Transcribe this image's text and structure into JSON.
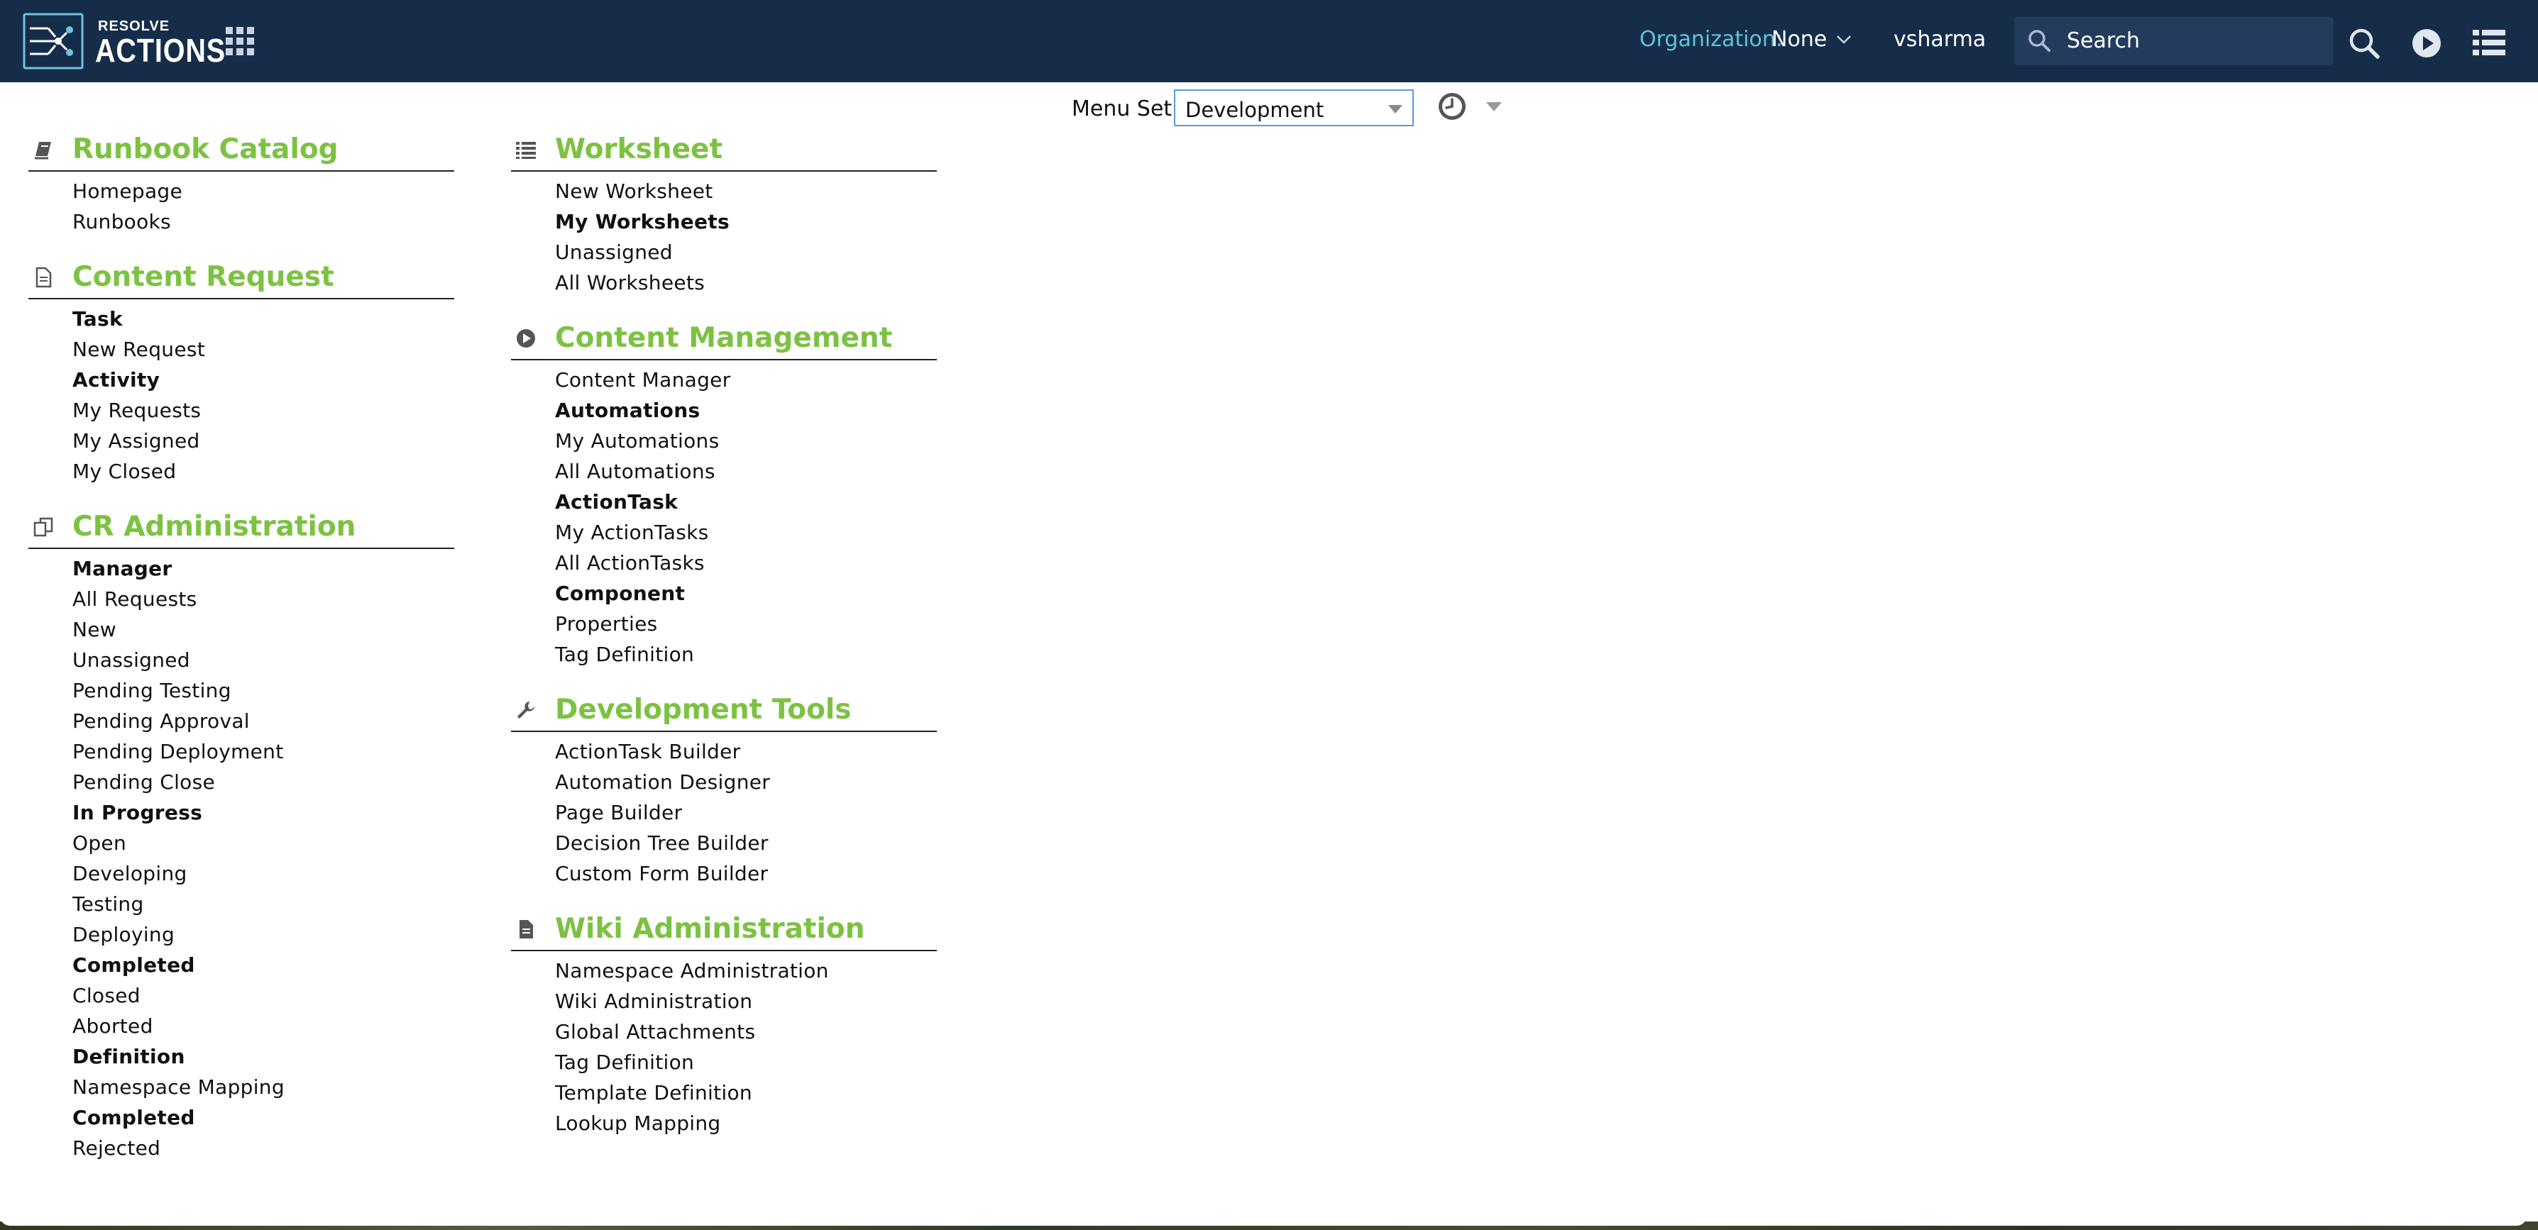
{
  "header": {
    "brand_top": "RESOLVE",
    "brand_main": "ACTIONS",
    "org_label": "Organization:",
    "org_value": "None",
    "username": "vsharma",
    "search_placeholder": "Search"
  },
  "menu_set": {
    "label": "Menu Set:",
    "value": "Development"
  },
  "columns": [
    [
      {
        "title": "Runbook Catalog",
        "icon": "book-icon",
        "items": [
          {
            "label": "Homepage",
            "group": false
          },
          {
            "label": "Runbooks",
            "group": false
          }
        ]
      },
      {
        "title": "Content Request",
        "icon": "document-icon",
        "items": [
          {
            "label": "Task",
            "group": true
          },
          {
            "label": "New Request",
            "group": false
          },
          {
            "label": "Activity",
            "group": true
          },
          {
            "label": "My Requests",
            "group": false
          },
          {
            "label": "My Assigned",
            "group": false
          },
          {
            "label": "My Closed",
            "group": false
          }
        ]
      },
      {
        "title": "CR Administration",
        "icon": "copy-icon",
        "items": [
          {
            "label": "Manager",
            "group": true
          },
          {
            "label": "All Requests",
            "group": false
          },
          {
            "label": "New",
            "group": false
          },
          {
            "label": "Unassigned",
            "group": false
          },
          {
            "label": "Pending Testing",
            "group": false
          },
          {
            "label": "Pending Approval",
            "group": false
          },
          {
            "label": "Pending Deployment",
            "group": false
          },
          {
            "label": "Pending Close",
            "group": false
          },
          {
            "label": "In Progress",
            "group": true
          },
          {
            "label": "Open",
            "group": false
          },
          {
            "label": "Developing",
            "group": false
          },
          {
            "label": "Testing",
            "group": false
          },
          {
            "label": "Deploying",
            "group": false
          },
          {
            "label": "Completed",
            "group": true
          },
          {
            "label": "Closed",
            "group": false
          },
          {
            "label": "Aborted",
            "group": false
          },
          {
            "label": "Definition",
            "group": true
          },
          {
            "label": "Namespace Mapping",
            "group": false
          },
          {
            "label": "Completed",
            "group": true
          },
          {
            "label": "Rejected",
            "group": false
          }
        ]
      }
    ],
    [
      {
        "title": "Worksheet",
        "icon": "list-icon",
        "items": [
          {
            "label": "New Worksheet",
            "group": false
          },
          {
            "label": "My Worksheets",
            "group": true
          },
          {
            "label": "Unassigned",
            "group": false
          },
          {
            "label": "All Worksheets",
            "group": false
          }
        ]
      },
      {
        "title": "Content Management",
        "icon": "play-circle-icon",
        "items": [
          {
            "label": "Content Manager",
            "group": false
          },
          {
            "label": "Automations",
            "group": true
          },
          {
            "label": "My Automations",
            "group": false
          },
          {
            "label": "All Automations",
            "group": false
          },
          {
            "label": "ActionTask",
            "group": true
          },
          {
            "label": "My ActionTasks",
            "group": false
          },
          {
            "label": "All ActionTasks",
            "group": false
          },
          {
            "label": "Component",
            "group": true
          },
          {
            "label": "Properties",
            "group": false
          },
          {
            "label": "Tag Definition",
            "group": false
          }
        ]
      },
      {
        "title": "Development Tools",
        "icon": "wrench-icon",
        "items": [
          {
            "label": "ActionTask Builder",
            "group": false
          },
          {
            "label": "Automation Designer",
            "group": false
          },
          {
            "label": "Page Builder",
            "group": false
          },
          {
            "label": "Decision Tree Builder",
            "group": false
          },
          {
            "label": "Custom Form Builder",
            "group": false
          }
        ]
      },
      {
        "title": "Wiki Administration",
        "icon": "file-icon",
        "items": [
          {
            "label": "Namespace Administration",
            "group": false
          },
          {
            "label": "Wiki Administration",
            "group": false
          },
          {
            "label": "Global Attachments",
            "group": false
          },
          {
            "label": "Tag Definition",
            "group": false
          },
          {
            "label": "Template Definition",
            "group": false
          },
          {
            "label": "Lookup Mapping",
            "group": false
          }
        ]
      }
    ]
  ]
}
